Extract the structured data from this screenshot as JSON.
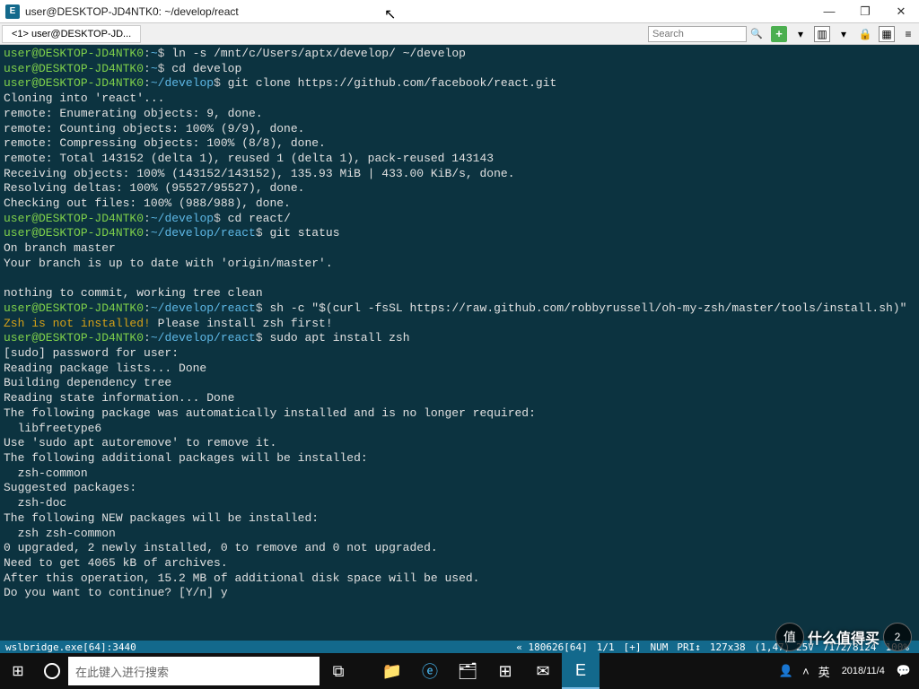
{
  "window": {
    "icon_label": "E",
    "title": "user@DESKTOP-JD4NTK0: ~/develop/react",
    "minimize": "—",
    "maximize": "❐",
    "close": "✕"
  },
  "tabbar": {
    "tab1": "<1> user@DESKTOP-JD...",
    "search_placeholder": "Search",
    "plus": "+",
    "down": "▾",
    "lock": "🔒"
  },
  "terminal_lines": [
    {
      "segs": [
        {
          "c": "prompt-user",
          "t": "user@DESKTOP-JD4NTK0"
        },
        {
          "c": "prompt-dollar",
          "t": ":"
        },
        {
          "c": "prompt-path",
          "t": "~"
        },
        {
          "c": "prompt-dollar",
          "t": "$ "
        },
        {
          "c": "cmd",
          "t": "ln -s /mnt/c/Users/aptx/develop/ ~/develop"
        }
      ]
    },
    {
      "segs": [
        {
          "c": "prompt-user",
          "t": "user@DESKTOP-JD4NTK0"
        },
        {
          "c": "prompt-dollar",
          "t": ":"
        },
        {
          "c": "prompt-path",
          "t": "~"
        },
        {
          "c": "prompt-dollar",
          "t": "$ "
        },
        {
          "c": "cmd",
          "t": "cd develop"
        }
      ]
    },
    {
      "segs": [
        {
          "c": "prompt-user",
          "t": "user@DESKTOP-JD4NTK0"
        },
        {
          "c": "prompt-dollar",
          "t": ":"
        },
        {
          "c": "prompt-path",
          "t": "~/develop"
        },
        {
          "c": "prompt-dollar",
          "t": "$ "
        },
        {
          "c": "cmd",
          "t": "git clone https://github.com/facebook/react.git"
        }
      ]
    },
    {
      "segs": [
        {
          "c": "cmd",
          "t": "Cloning into 'react'..."
        }
      ]
    },
    {
      "segs": [
        {
          "c": "cmd",
          "t": "remote: Enumerating objects: 9, done."
        }
      ]
    },
    {
      "segs": [
        {
          "c": "cmd",
          "t": "remote: Counting objects: 100% (9/9), done."
        }
      ]
    },
    {
      "segs": [
        {
          "c": "cmd",
          "t": "remote: Compressing objects: 100% (8/8), done."
        }
      ]
    },
    {
      "segs": [
        {
          "c": "cmd",
          "t": "remote: Total 143152 (delta 1), reused 1 (delta 1), pack-reused 143143"
        }
      ]
    },
    {
      "segs": [
        {
          "c": "cmd",
          "t": "Receiving objects: 100% (143152/143152), 135.93 MiB | 433.00 KiB/s, done."
        }
      ]
    },
    {
      "segs": [
        {
          "c": "cmd",
          "t": "Resolving deltas: 100% (95527/95527), done."
        }
      ]
    },
    {
      "segs": [
        {
          "c": "cmd",
          "t": "Checking out files: 100% (988/988), done."
        }
      ]
    },
    {
      "segs": [
        {
          "c": "prompt-user",
          "t": "user@DESKTOP-JD4NTK0"
        },
        {
          "c": "prompt-dollar",
          "t": ":"
        },
        {
          "c": "prompt-path",
          "t": "~/develop"
        },
        {
          "c": "prompt-dollar",
          "t": "$ "
        },
        {
          "c": "cmd",
          "t": "cd react/"
        }
      ]
    },
    {
      "segs": [
        {
          "c": "prompt-user",
          "t": "user@DESKTOP-JD4NTK0"
        },
        {
          "c": "prompt-dollar",
          "t": ":"
        },
        {
          "c": "prompt-path",
          "t": "~/develop/react"
        },
        {
          "c": "prompt-dollar",
          "t": "$ "
        },
        {
          "c": "cmd",
          "t": "git status"
        }
      ]
    },
    {
      "segs": [
        {
          "c": "cmd",
          "t": "On branch master"
        }
      ]
    },
    {
      "segs": [
        {
          "c": "cmd",
          "t": "Your branch is up to date with 'origin/master'."
        }
      ]
    },
    {
      "segs": [
        {
          "c": "cmd",
          "t": " "
        }
      ]
    },
    {
      "segs": [
        {
          "c": "cmd",
          "t": "nothing to commit, working tree clean"
        }
      ]
    },
    {
      "segs": [
        {
          "c": "prompt-user",
          "t": "user@DESKTOP-JD4NTK0"
        },
        {
          "c": "prompt-dollar",
          "t": ":"
        },
        {
          "c": "prompt-path",
          "t": "~/develop/react"
        },
        {
          "c": "prompt-dollar",
          "t": "$ "
        },
        {
          "c": "cmd",
          "t": "sh -c \"$(curl -fsSL https://raw.github.com/robbyrussell/oh-my-zsh/master/tools/install.sh)\""
        }
      ]
    },
    {
      "segs": [
        {
          "c": "warn",
          "t": "Zsh is not installed!"
        },
        {
          "c": "cmd",
          "t": " Please install zsh first!"
        }
      ]
    },
    {
      "segs": [
        {
          "c": "prompt-user",
          "t": "user@DESKTOP-JD4NTK0"
        },
        {
          "c": "prompt-dollar",
          "t": ":"
        },
        {
          "c": "prompt-path",
          "t": "~/develop/react"
        },
        {
          "c": "prompt-dollar",
          "t": "$ "
        },
        {
          "c": "cmd",
          "t": "sudo apt install zsh"
        }
      ]
    },
    {
      "segs": [
        {
          "c": "cmd",
          "t": "[sudo] password for user:"
        }
      ]
    },
    {
      "segs": [
        {
          "c": "cmd",
          "t": "Reading package lists... Done"
        }
      ]
    },
    {
      "segs": [
        {
          "c": "cmd",
          "t": "Building dependency tree"
        }
      ]
    },
    {
      "segs": [
        {
          "c": "cmd",
          "t": "Reading state information... Done"
        }
      ]
    },
    {
      "segs": [
        {
          "c": "cmd",
          "t": "The following package was automatically installed and is no longer required:"
        }
      ]
    },
    {
      "segs": [
        {
          "c": "cmd",
          "t": "  libfreetype6"
        }
      ]
    },
    {
      "segs": [
        {
          "c": "cmd",
          "t": "Use 'sudo apt autoremove' to remove it."
        }
      ]
    },
    {
      "segs": [
        {
          "c": "cmd",
          "t": "The following additional packages will be installed:"
        }
      ]
    },
    {
      "segs": [
        {
          "c": "cmd",
          "t": "  zsh-common"
        }
      ]
    },
    {
      "segs": [
        {
          "c": "cmd",
          "t": "Suggested packages:"
        }
      ]
    },
    {
      "segs": [
        {
          "c": "cmd",
          "t": "  zsh-doc"
        }
      ]
    },
    {
      "segs": [
        {
          "c": "cmd",
          "t": "The following NEW packages will be installed:"
        }
      ]
    },
    {
      "segs": [
        {
          "c": "cmd",
          "t": "  zsh zsh-common"
        }
      ]
    },
    {
      "segs": [
        {
          "c": "cmd",
          "t": "0 upgraded, 2 newly installed, 0 to remove and 0 not upgraded."
        }
      ]
    },
    {
      "segs": [
        {
          "c": "cmd",
          "t": "Need to get 4065 kB of archives."
        }
      ]
    },
    {
      "segs": [
        {
          "c": "cmd",
          "t": "After this operation, 15.2 MB of additional disk space will be used."
        }
      ]
    },
    {
      "segs": [
        {
          "c": "cmd",
          "t": "Do you want to continue? [Y/n] y"
        }
      ]
    }
  ],
  "statusbar": {
    "left": "wslbridge.exe[64]:3440",
    "session": "« 180626[64]",
    "pages": "1/1",
    "plus": "[+]",
    "num": "NUM",
    "pri": "PRI↕",
    "size": "127x38",
    "pos": "(1,47) 25V",
    "mem": "7172/8124",
    "pct": "100%"
  },
  "taskbar": {
    "search_placeholder": "在此键入进行搜索",
    "time": "2018/11/4"
  },
  "watermark": {
    "circle": "值",
    "text": "什么值得买",
    "badge": "2"
  }
}
